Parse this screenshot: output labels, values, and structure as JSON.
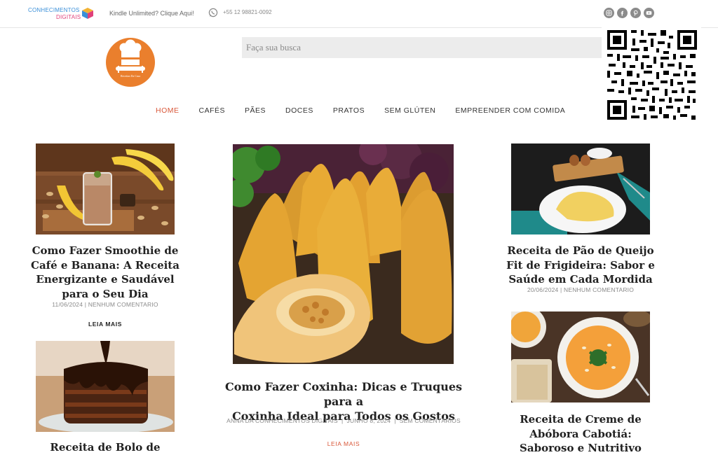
{
  "topbar": {
    "brand_line1": "CONHECIMENTOS",
    "brand_line2": "DIGITAIS",
    "kindle_link": "Kindle Unlimited? Clique Aqui!",
    "phone": "+55 12 98821-0092"
  },
  "social": [
    "instagram-icon",
    "facebook-icon",
    "pinterest-icon",
    "youtube-icon"
  ],
  "logo": {
    "text": "Receitas Da Casa"
  },
  "search": {
    "placeholder": "Faça sua busca"
  },
  "nav": {
    "items": [
      {
        "label": "HOME",
        "active": true
      },
      {
        "label": "CAFÉS"
      },
      {
        "label": "PÃES"
      },
      {
        "label": "DOCES"
      },
      {
        "label": "PRATOS"
      },
      {
        "label": "SEM GLÚTEN"
      },
      {
        "label": "EMPREENDER COM COMIDA"
      }
    ]
  },
  "posts": {
    "smoothie": {
      "title_lines": [
        "Como Fazer Smoothie de",
        "Café e Banana: A Receita",
        "Energizante e Saudável",
        "para o Seu Dia"
      ],
      "meta": "11/06/2024 | NENHUM COMENTARIO",
      "more": "LEIA MAIS"
    },
    "bolo": {
      "title_lines": [
        "Receita de Bolo de"
      ]
    },
    "coxinha": {
      "title_lines": [
        "Como Fazer Coxinha: Dicas e Truques para a",
        "Coxinha Ideal para Todos os Gostos"
      ],
      "meta": "ANNA DA CONHECIMENTOS DIGITAIS  |  JUNHO 8, 2024  |  SEM COMENTÁRIOS",
      "more": "LEIA MAIS"
    },
    "pao_queijo": {
      "title_lines": [
        "Receita de Pão de Queijo",
        "Fit de Frigideira: Sabor e",
        "Saúde em Cada Mordida"
      ],
      "meta": "20/06/2024 | NENHUM COMENTARIO"
    },
    "abobora": {
      "title_lines": [
        "Receita de Creme de",
        "Abóbora Cabotiá:",
        "Saboroso e Nutritivo"
      ]
    }
  },
  "colors": {
    "accent": "#d9583a",
    "logo_bg": "#ea7f2d",
    "search_bg": "#ececec"
  }
}
